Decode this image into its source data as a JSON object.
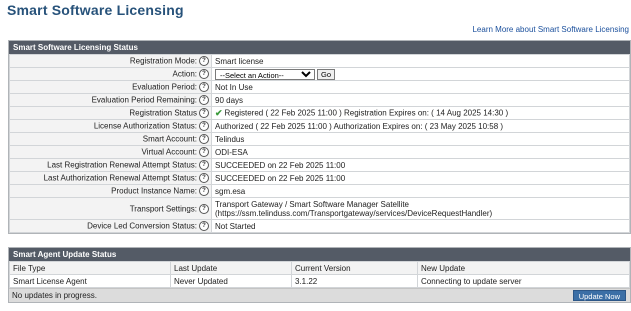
{
  "page": {
    "title": "Smart Software Licensing",
    "learn_more_link": "Learn More about Smart Software Licensing"
  },
  "status_panel": {
    "header": "Smart Software Licensing Status",
    "help_glyph": "?",
    "rows": {
      "registration_mode": {
        "label": "Registration Mode:",
        "value": "Smart license"
      },
      "action": {
        "label": "Action:",
        "select_value": "--Select an Action--",
        "go_label": "Go"
      },
      "evaluation_period": {
        "label": "Evaluation Period:",
        "value": "Not In Use"
      },
      "evaluation_remaining": {
        "label": "Evaluation Period Remaining:",
        "value": "90 days"
      },
      "registration_status": {
        "label": "Registration Status",
        "value": "Registered ( 22 Feb 2025 11:00 ) Registration Expires on: ( 14 Aug 2025 14:30 )"
      },
      "license_auth_status": {
        "label": "License Authorization Status:",
        "value": "Authorized ( 22 Feb 2025 11:00 ) Authorization Expires on: ( 23 May 2025 10:58 )"
      },
      "smart_account": {
        "label": "Smart Account:",
        "value": "Telindus"
      },
      "virtual_account": {
        "label": "Virtual Account:",
        "value": "ODI-ESA"
      },
      "last_reg_renewal": {
        "label": "Last Registration Renewal Attempt Status:",
        "value": "SUCCEEDED on 22 Feb 2025 11:00"
      },
      "last_auth_renewal": {
        "label": "Last Authorization Renewal Attempt Status:",
        "value": "SUCCEEDED on 22 Feb 2025 11:00"
      },
      "product_instance": {
        "label": "Product Instance Name:",
        "value": "sgm.esa"
      },
      "transport_settings": {
        "label": "Transport Settings:",
        "value_line1": "Transport Gateway / Smart Software Manager Satellite",
        "value_line2": "(https://ssm.telinduss.com/Transportgateway/services/DeviceRequestHandler)"
      },
      "device_led": {
        "label": "Device Led Conversion Status:",
        "value": "Not Started"
      }
    },
    "check_icon": "check-icon",
    "check_color": "#3a9a3a"
  },
  "agent_panel": {
    "header": "Smart Agent Update Status",
    "columns": [
      "File Type",
      "Last Update",
      "Current Version",
      "New Update"
    ],
    "row": [
      "Smart License Agent",
      "Never Updated",
      "3.1.22",
      "Connecting to update server"
    ],
    "footer_text": "No updates in progress.",
    "update_button": "Update Now"
  },
  "colors": {
    "title": "#27527a",
    "header_bg": "#545b66",
    "link": "#1a4f9c",
    "button_bg": "#3b6fa6"
  }
}
